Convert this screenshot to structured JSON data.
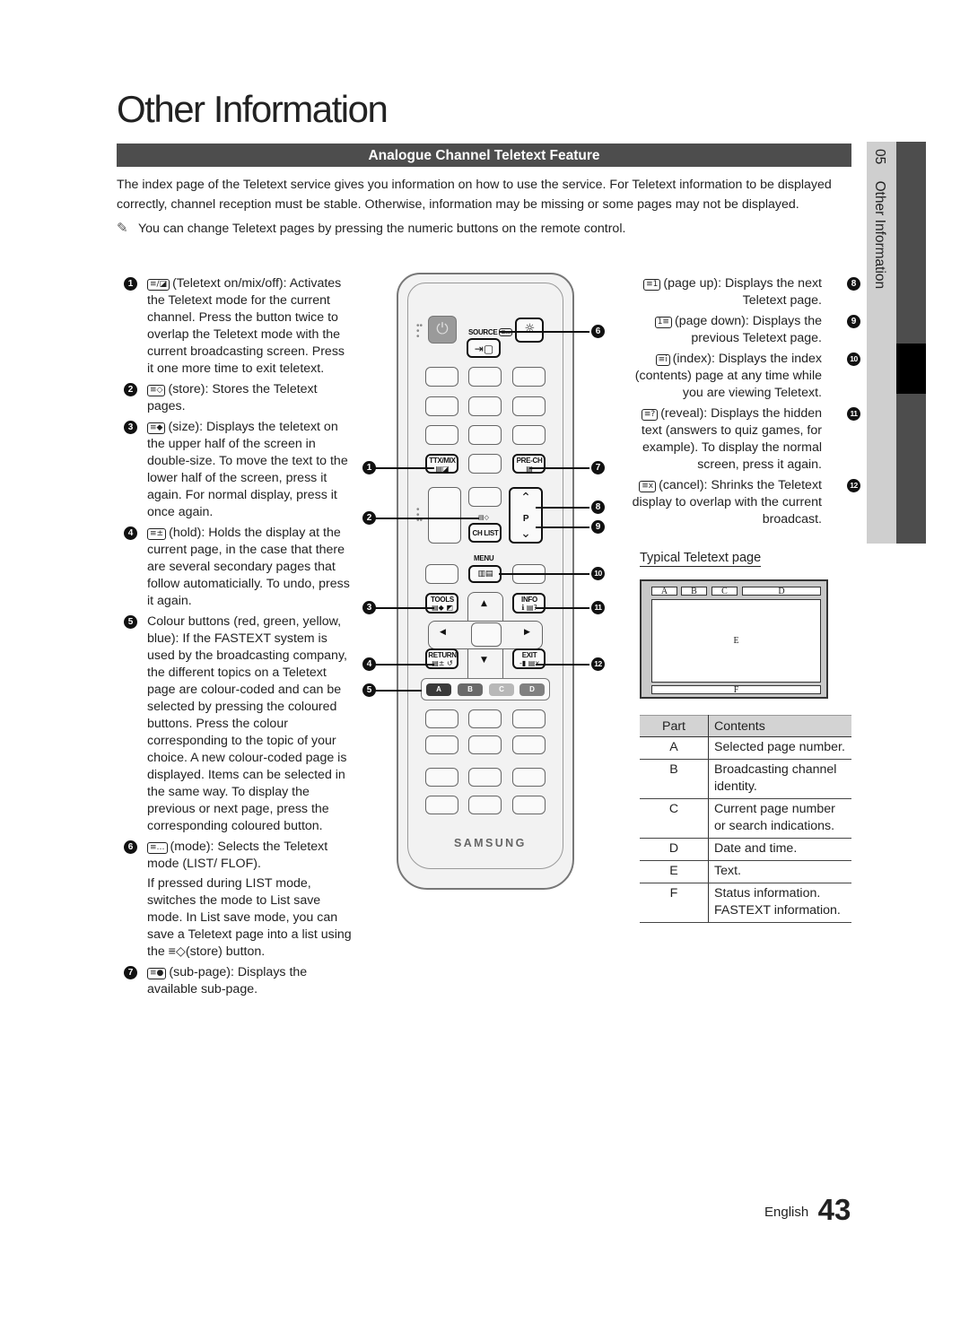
{
  "page": {
    "title": "Other Information",
    "language": "English",
    "page_number": "43"
  },
  "side_tab": {
    "chapter": "05",
    "label": "Other Information"
  },
  "section": {
    "title": "Analogue Channel Teletext Feature",
    "intro": "The index page of the Teletext service gives you information on how to use the service. For Teletext information to be displayed correctly, channel reception must be stable. Otherwise, information may be missing or some pages may not be displayed.",
    "note_icon": "pencil-note-icon",
    "note": "You can change Teletext pages by pressing the numeric buttons on the remote control."
  },
  "left_items": [
    {
      "num": "1",
      "icon": "≡/◪",
      "paras": [
        "(Teletext on/mix/off): Activates the Teletext mode for the current channel. Press the button twice to overlap the Teletext mode with the current broadcasting screen. Press it one more time to exit teletext."
      ]
    },
    {
      "num": "2",
      "icon": "≡◇",
      "paras": [
        "(store): Stores the Teletext pages."
      ]
    },
    {
      "num": "3",
      "icon": "≡◆",
      "paras": [
        "(size): Displays the teletext on the upper half of the screen in double-size. To move the text to the lower half of the screen, press it again. For normal display, press it once again."
      ]
    },
    {
      "num": "4",
      "icon": "≡±",
      "paras": [
        "(hold): Holds the display at the current page, in the case that there are several secondary pages that follow automaticially. To undo, press it again."
      ]
    },
    {
      "num": "5",
      "icon": "",
      "paras": [
        "Colour buttons (red, green, yellow, blue): If the FASTEXT system is used by the broadcasting company, the different topics on a Teletext page are colour-coded and can be selected by pressing the coloured buttons. Press the colour corresponding to the topic of your choice. A new colour-coded page is displayed. Items can be selected in the same way. To display the previous or next page, press the corresponding coloured button."
      ]
    },
    {
      "num": "6",
      "icon": "≡…",
      "paras": [
        "(mode): Selects the Teletext mode (LIST/ FLOF).",
        "If pressed during LIST mode, switches the mode to List save mode. In List save mode, you can save a Teletext page into a list using the ≡◇(store) button."
      ]
    },
    {
      "num": "7",
      "icon": "≡●",
      "paras": [
        "(sub-page): Displays the available sub-page."
      ]
    }
  ],
  "right_items": [
    {
      "num": "8",
      "icon": "≡1",
      "text": "(page up): Displays the next Teletext page."
    },
    {
      "num": "9",
      "icon": "1≡",
      "text": "(page down): Displays the previous Teletext page."
    },
    {
      "num": "10",
      "icon": "≡i",
      "text": "(index): Displays the index (contents) page at any time while you are viewing Teletext."
    },
    {
      "num": "11",
      "icon": "≡?",
      "text": "(reveal): Displays the hidden text (answers to quiz games, for example). To display the normal screen, press it again."
    },
    {
      "num": "12",
      "icon": "≡x",
      "text": "(cancel): Shrinks the Teletext display to overlap with the current broadcast."
    }
  ],
  "teletext_diagram": {
    "label": "Typical Teletext page",
    "parts": [
      "A",
      "B",
      "C",
      "D",
      "E",
      "F"
    ]
  },
  "parts_table": {
    "headers": [
      "Part",
      "Contents"
    ],
    "rows": [
      {
        "part": "A",
        "contents": "Selected page number."
      },
      {
        "part": "B",
        "contents": "Broadcasting channel identity."
      },
      {
        "part": "C",
        "contents": "Current page number or search indications."
      },
      {
        "part": "D",
        "contents": "Date and time."
      },
      {
        "part": "E",
        "contents": "Text."
      },
      {
        "part": "F",
        "contents": "Status information. FASTEXT information."
      }
    ]
  },
  "remote": {
    "brand": "SAMSUNG",
    "labels": {
      "source": "SOURCE",
      "ttx_mix": "TTX/MIX",
      "pre_ch": "PRE-CH",
      "ch_list": "CH LIST",
      "p": "P",
      "menu": "MENU",
      "tools": "TOOLS",
      "info": "INFO",
      "return": "RETURN",
      "exit": "EXIT"
    },
    "color_keys": [
      {
        "label": "A",
        "color": "#3a3a3a"
      },
      {
        "label": "B",
        "color": "#6a6a6a"
      },
      {
        "label": "C",
        "color": "#b8b8b8"
      },
      {
        "label": "D",
        "color": "#808080"
      }
    ],
    "callouts": [
      "1",
      "2",
      "3",
      "4",
      "5",
      "6",
      "7",
      "8",
      "9",
      "10",
      "11",
      "12"
    ]
  },
  "colors": {
    "section_bar": "#4d4d4d",
    "side_tab_light": "#cfcfcf",
    "side_tab_dark": "#4d4d4d",
    "table_header": "#d3d3d3"
  }
}
